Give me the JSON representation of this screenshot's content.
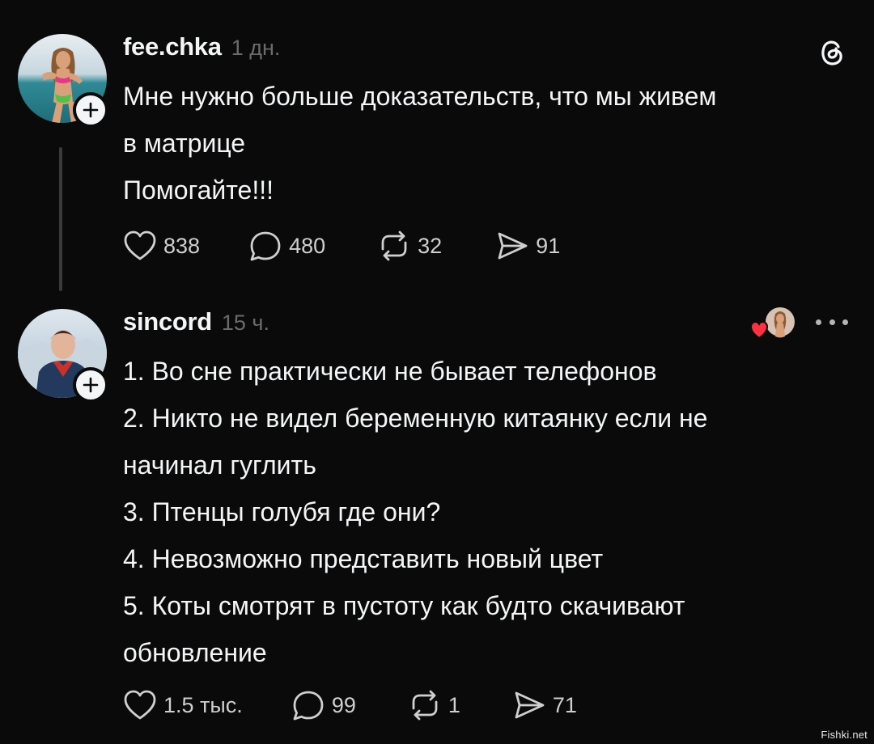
{
  "post": {
    "username": "fee.chka",
    "time": "1 дн.",
    "text_lines": [
      "Мне нужно больше доказательств, что мы живем",
      "в матрице",
      "Помогайте!!!"
    ],
    "stats": {
      "likes": "838",
      "replies": "480",
      "reposts": "32",
      "shares": "91"
    }
  },
  "reply": {
    "username": "sincord",
    "time": "15 ч.",
    "text_lines": [
      "1. Во сне практически не бывает телефонов",
      "2. Никто не видел беременную китаянку если не",
      "начинал гуглить",
      "3. Птенцы голубя где они?",
      "4. Невозможно представить новый цвет",
      "5. Коты смотрят в пустоту как будто скачивают",
      "обновление"
    ],
    "stats": {
      "likes": "1.5 тыс.",
      "replies": "99",
      "reposts": "1",
      "shares": "71"
    }
  },
  "watermark": "Fishki.net",
  "icons": {
    "app_logo": "threads-logo-icon",
    "like": "heart-icon",
    "reply": "comment-bubble-icon",
    "repost": "repost-icon",
    "share": "send-icon",
    "follow": "plus-icon",
    "more": "more-dots-icon",
    "liked_by_author": "author-liked-heart-icon"
  },
  "colors": {
    "background": "#0a0a0a",
    "text": "#f3f5f7",
    "muted": "#6b6b6b",
    "like_red": "#ff3040"
  }
}
